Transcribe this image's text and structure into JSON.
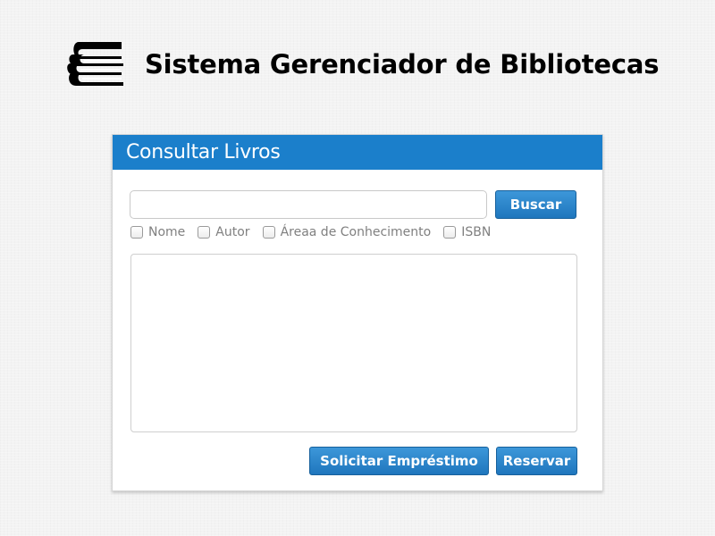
{
  "app": {
    "title": "Sistema Gerenciador de Bibliotecas",
    "logo_icon": "books-stack-icon"
  },
  "panel": {
    "title": "Consultar Livros",
    "header_color": "#1b7fcb",
    "search": {
      "value": "",
      "placeholder": "",
      "button_label": "Buscar"
    },
    "filters": [
      {
        "label": "Nome",
        "checked": false
      },
      {
        "label": "Autor",
        "checked": false
      },
      {
        "label": "Áreaa de Conhecimento",
        "checked": false
      },
      {
        "label": "ISBN",
        "checked": false
      }
    ],
    "results": [],
    "actions": {
      "loan_label": "Solicitar Empréstimo",
      "reserve_label": "Reservar"
    }
  },
  "colors": {
    "accent": "#1b7fcb",
    "button": "#2a86c9",
    "background": "#f3f3f3"
  }
}
